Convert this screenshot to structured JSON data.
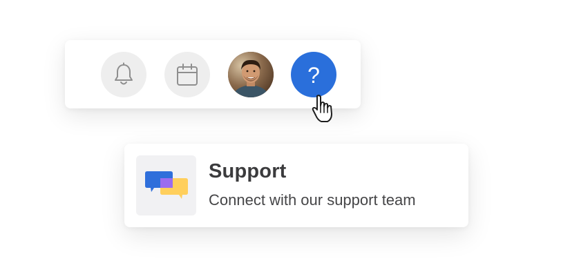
{
  "toolbar": {
    "icons": {
      "notifications": "bell-icon",
      "calendar": "calendar-icon",
      "profile": "user-avatar",
      "help": "help-icon"
    },
    "help_label": "?",
    "help_color": "#2a6fdb",
    "button_bg": "#eeeeee"
  },
  "cursor": {
    "icon": "hand-pointer-icon"
  },
  "support_card": {
    "icon": "chat-bubbles-icon",
    "title": "Support",
    "subtitle": "Connect with our support team",
    "colors": {
      "bubble_blue": "#2f6fdb",
      "bubble_yellow": "#ffcf5c",
      "overlap_purple": "#9b6cf0"
    }
  }
}
